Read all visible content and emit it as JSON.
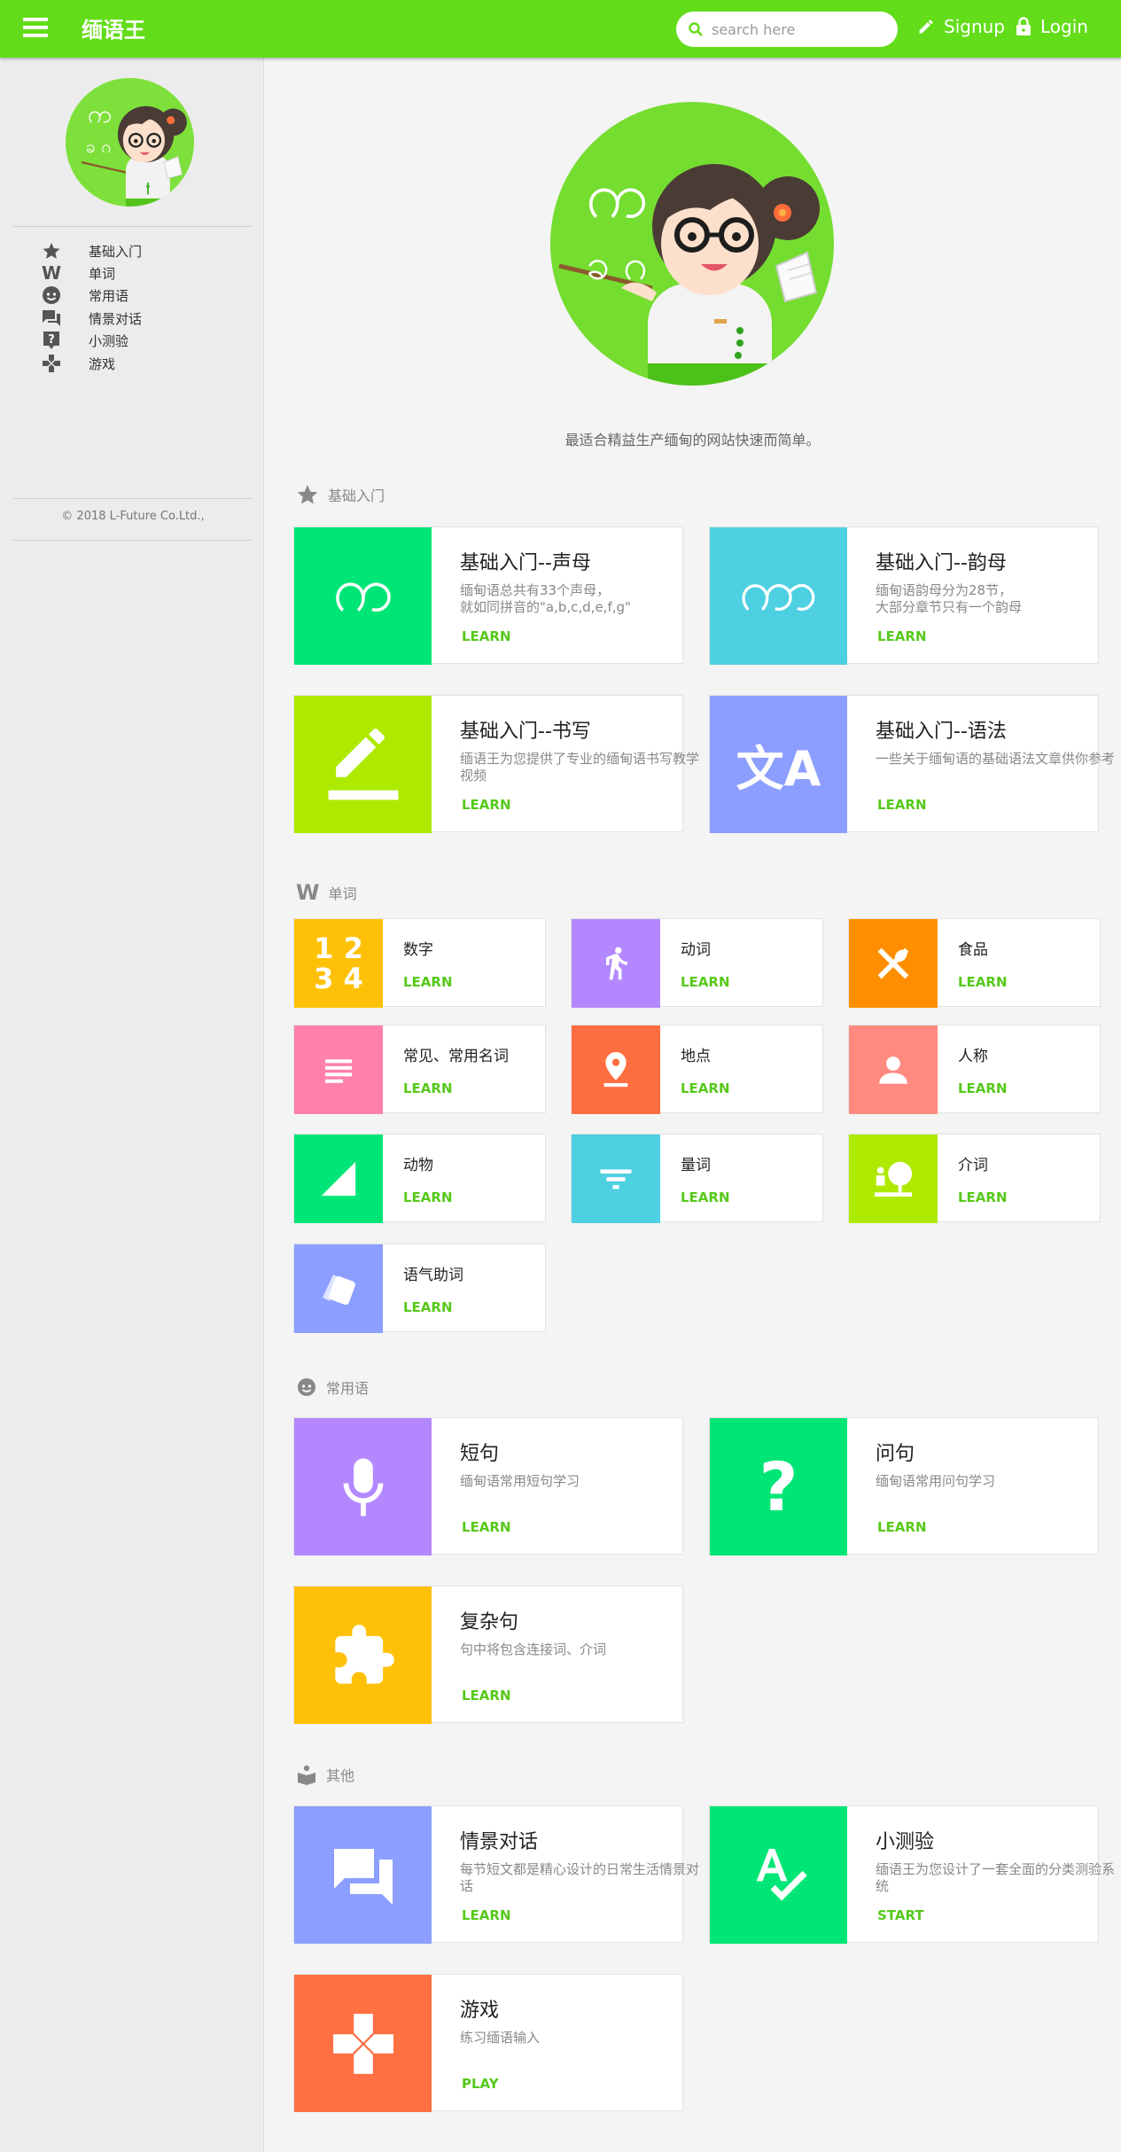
{
  "header": {
    "title": "缅语王",
    "search_placeholder": "search here",
    "signup_label": "Signup",
    "login_label": "Login"
  },
  "sidebar": {
    "items": [
      {
        "label": "基础入门",
        "icon": "star-icon"
      },
      {
        "label": "单词",
        "icon": "w-icon"
      },
      {
        "label": "常用语",
        "icon": "face-icon"
      },
      {
        "label": "情景对话",
        "icon": "chat-icon"
      },
      {
        "label": "小测验",
        "icon": "question-icon"
      },
      {
        "label": "游戏",
        "icon": "gamepad-icon"
      }
    ],
    "copyright": "© 2018 L-Future Co.Ltd.,"
  },
  "hero": {
    "tagline": "最适合精益生产缅甸的网站快速而简单。",
    "letters": "ကခဂ"
  },
  "sections": {
    "basics": {
      "title": "基础入门",
      "cards": [
        {
          "title": "基础入门--声母",
          "desc": "缅甸语总共有33个声母，\n就如同拼音的\"a,b,c,d,e,f,g\"",
          "action": "LEARN",
          "color": "#00e676",
          "glyph": "က"
        },
        {
          "title": "基础入门--韵母",
          "desc": "缅甸语韵母分为28节，\n大部分章节只有一个韵母",
          "action": "LEARN",
          "color": "#4dd0e1",
          "glyph": "ကာ"
        },
        {
          "title": "基础入门--书写",
          "desc": "缅语王为您提供了专业的缅甸语书写教学视频",
          "action": "LEARN",
          "color": "#aeea00",
          "glyph": ""
        },
        {
          "title": "基础入门--语法",
          "desc": "一些关于缅甸语的基础语法文章供你参考",
          "action": "LEARN",
          "color": "#8c9eff",
          "glyph": "文A"
        }
      ]
    },
    "words": {
      "title": "单词",
      "cards": [
        {
          "title": "数字",
          "action": "LEARN",
          "color": "#ffc107",
          "icon": "numbers-icon"
        },
        {
          "title": "动词",
          "action": "LEARN",
          "color": "#b388ff",
          "icon": "walk-icon"
        },
        {
          "title": "食品",
          "action": "LEARN",
          "color": "#ff8f00",
          "icon": "food-icon"
        },
        {
          "title": "常见、常用名词",
          "action": "LEARN",
          "color": "#ff80ab",
          "icon": "list-icon"
        },
        {
          "title": "地点",
          "action": "LEARN",
          "color": "#ff6e40",
          "icon": "pin-icon"
        },
        {
          "title": "人称",
          "action": "LEARN",
          "color": "#ff8a80",
          "icon": "person-icon"
        },
        {
          "title": "动物",
          "action": "LEARN",
          "color": "#00e676",
          "icon": "signal-icon"
        },
        {
          "title": "量词",
          "action": "LEARN",
          "color": "#4dd0e1",
          "icon": "filter-icon"
        },
        {
          "title": "介词",
          "action": "LEARN",
          "color": "#aeea00",
          "icon": "tree-icon"
        },
        {
          "title": "语气助词",
          "action": "LEARN",
          "color": "#8c9eff",
          "icon": "tag-icon"
        }
      ]
    },
    "phrases": {
      "title": "常用语",
      "cards": [
        {
          "title": "短句",
          "desc": "缅甸语常用短句学习",
          "action": "LEARN",
          "color": "#b388ff",
          "icon": "mic-icon"
        },
        {
          "title": "问句",
          "desc": "缅甸语常用问句学习",
          "action": "LEARN",
          "color": "#00e676",
          "icon": "question-mark-icon"
        },
        {
          "title": "复杂句",
          "desc": "句中将包含连接词、介词",
          "action": "LEARN",
          "color": "#ffc107",
          "icon": "puzzle-icon"
        }
      ]
    },
    "other": {
      "title": "其他",
      "cards": [
        {
          "title": "情景对话",
          "desc": "每节短文都是精心设计的日常生活情景对话",
          "action": "LEARN",
          "color": "#8c9eff",
          "icon": "chat-icon"
        },
        {
          "title": "小测验",
          "desc": "缅语王为您设计了一套全面的分类测验系统",
          "action": "START",
          "color": "#00e676",
          "icon": "spellcheck-icon"
        },
        {
          "title": "游戏",
          "desc": "练习缅语输入",
          "action": "PLAY",
          "color": "#ff7043",
          "icon": "gamepad-icon"
        }
      ]
    }
  },
  "colors": {
    "brand": "#63dd1a",
    "action": "#56c91a"
  }
}
